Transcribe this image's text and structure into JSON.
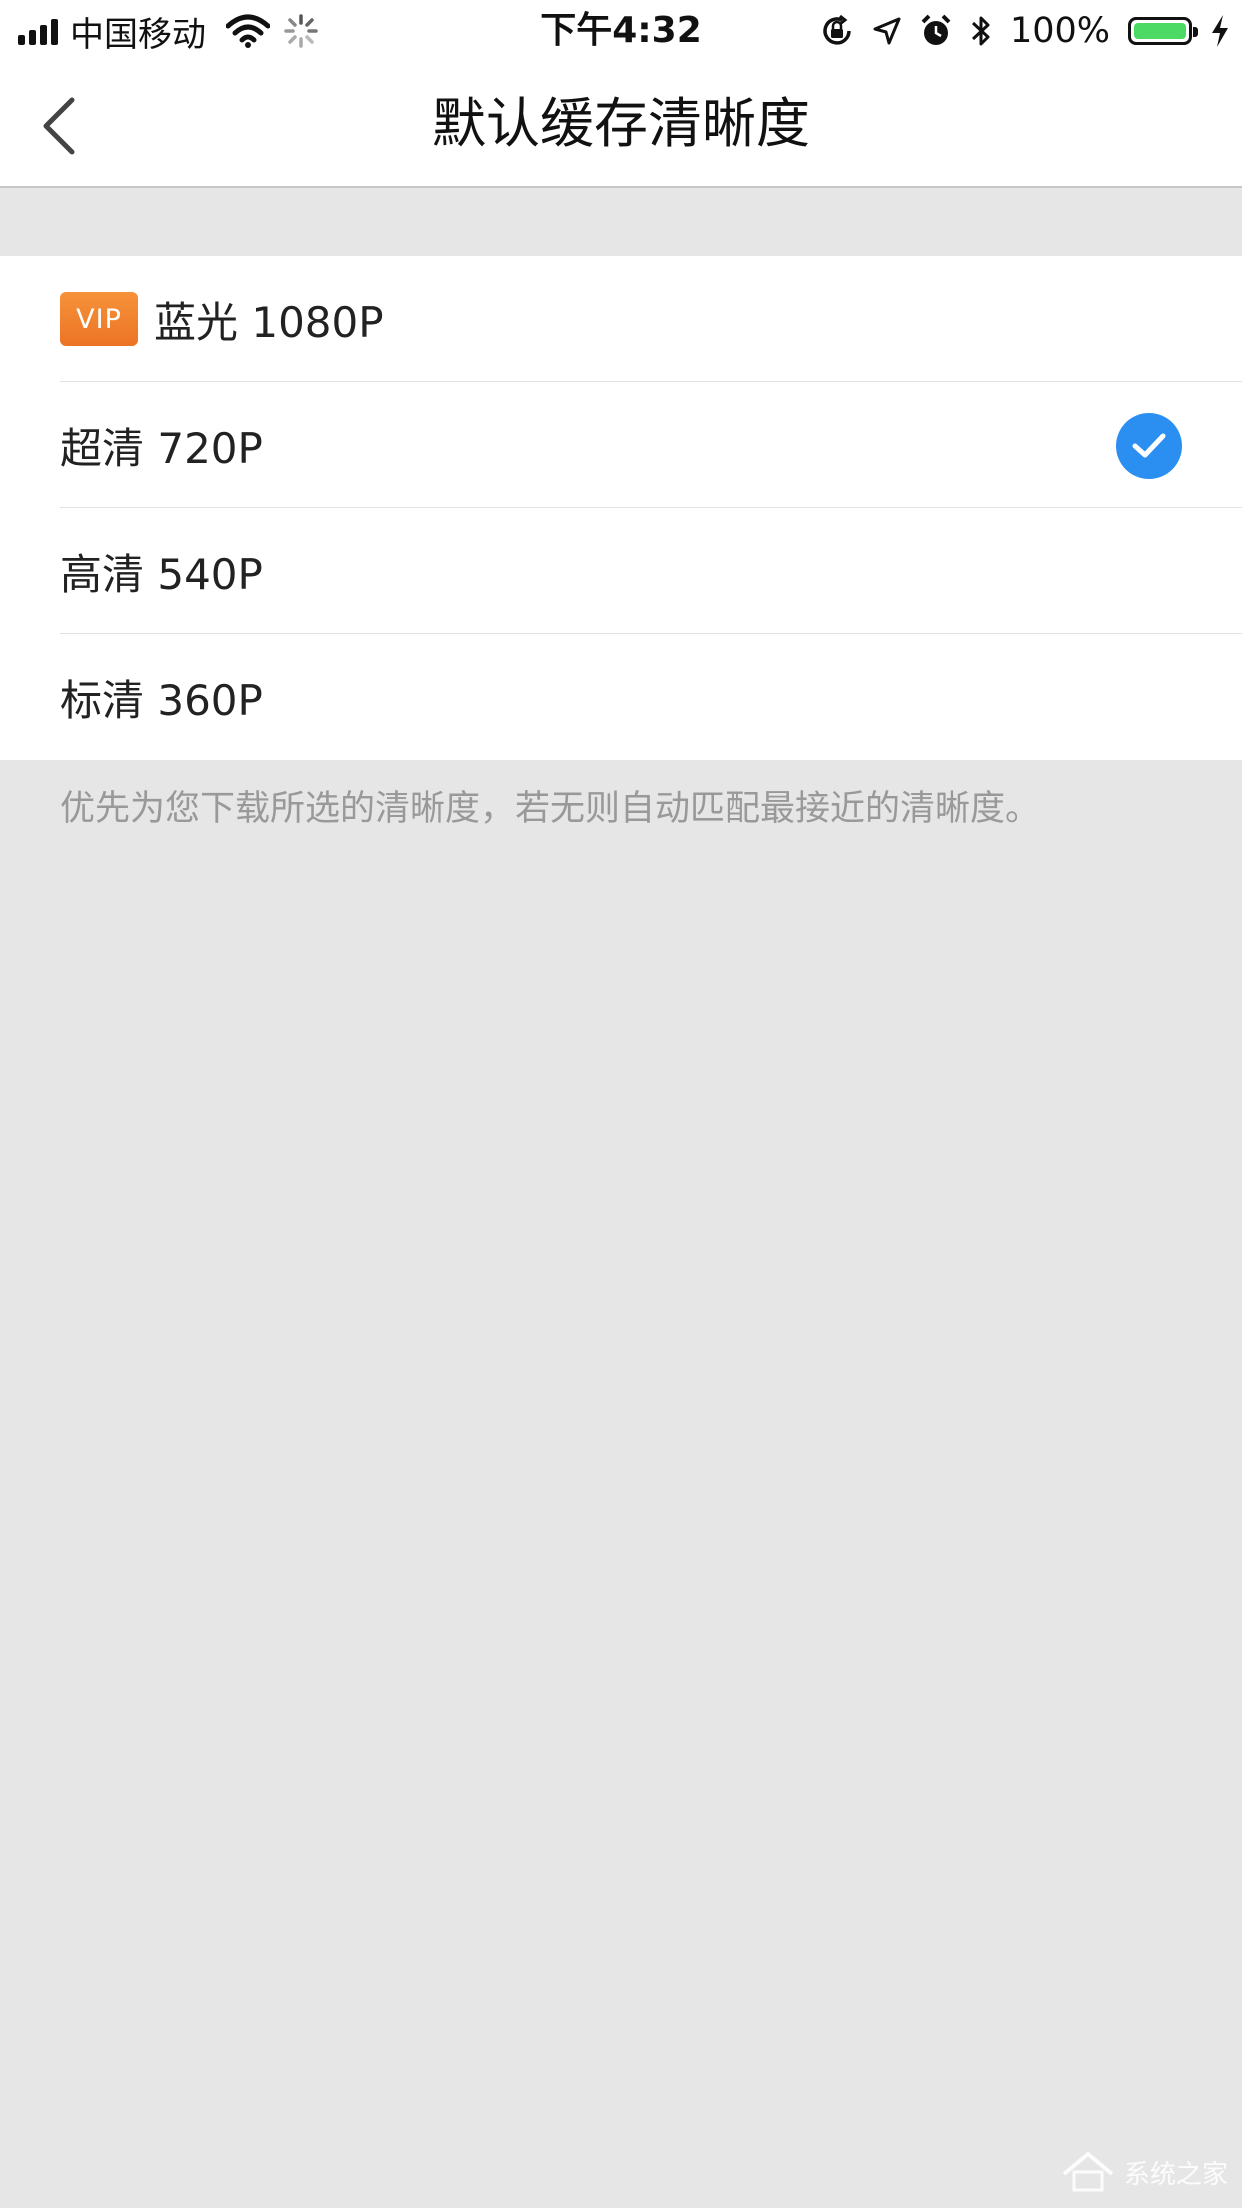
{
  "status_bar": {
    "carrier": "中国移动",
    "time": "下午4:32",
    "battery": "100%",
    "icons": [
      "signal-icon",
      "wifi-icon",
      "loading-icon",
      "rotation-lock-icon",
      "location-icon",
      "alarm-icon",
      "bluetooth-icon",
      "battery-icon",
      "charging-icon"
    ],
    "battery_color": "#4cd964"
  },
  "nav": {
    "title": "默认缓存清晰度",
    "back_icon": "chevron-left-icon"
  },
  "options": [
    {
      "badge": "VIP",
      "label": "蓝光 1080P",
      "selected": false
    },
    {
      "label": "超清 720P",
      "selected": true
    },
    {
      "label": "高清 540P",
      "selected": false
    },
    {
      "label": "标清 360P",
      "selected": false
    }
  ],
  "note": "优先为您下载所选的清晰度，若无则自动匹配最接近的清晰度。",
  "watermark": "系统之家",
  "colors": {
    "accent": "#2b8ff2",
    "vip_badge": "#f08030",
    "background": "#e6e6e6"
  }
}
